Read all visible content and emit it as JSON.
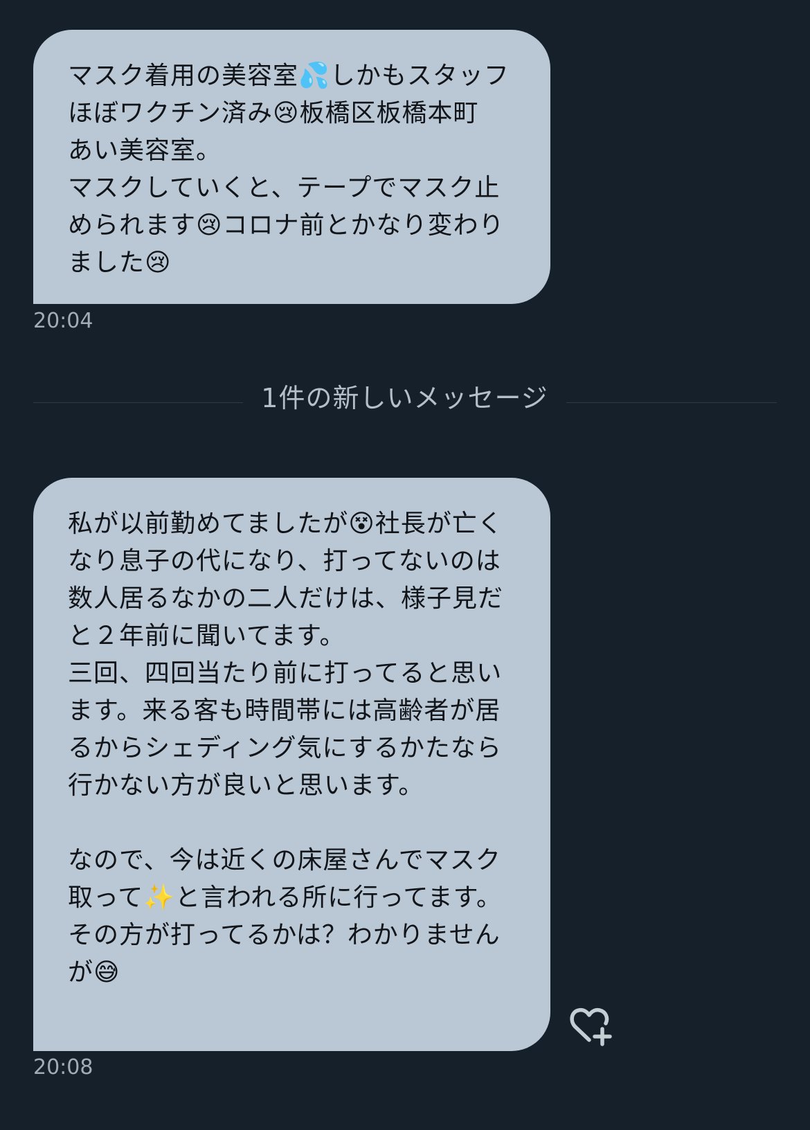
{
  "conversation": {
    "messages": [
      {
        "text": "マスク着用の美容室💦しかもスタッフほぼワクチン済み😢板橋区板橋本町　あい美容室。\nマスクしていくと、テープでマスク止められます😢コロナ前とかなり変わりました😢",
        "time": "20:04"
      },
      {
        "text": "私が以前勤めてましたが😵社長が亡くなり息子の代になり、打ってないのは数人居るなかの二人だけは、様子見だと２年前に聞いてます。\n三回、四回当たり前に打ってると思います。来る客も時間帯には高齢者が居るからシェディング気にするかたなら行かない方が良いと思います。\n\nなので、今は近くの床屋さんでマスク取って✨と言われる所に行ってます。その方が打ってるかは？わかりませんが😅",
        "time": "20:08"
      }
    ],
    "new_message_divider": "1件の新しいメッセージ"
  },
  "icons": {
    "reaction": "heart-plus-icon"
  },
  "colors": {
    "background": "#16202b",
    "bubble": "#bac8d6",
    "timestamp": "#a2acb6",
    "divider_line": "#2f3b47",
    "icon": "#c4ccd4"
  }
}
